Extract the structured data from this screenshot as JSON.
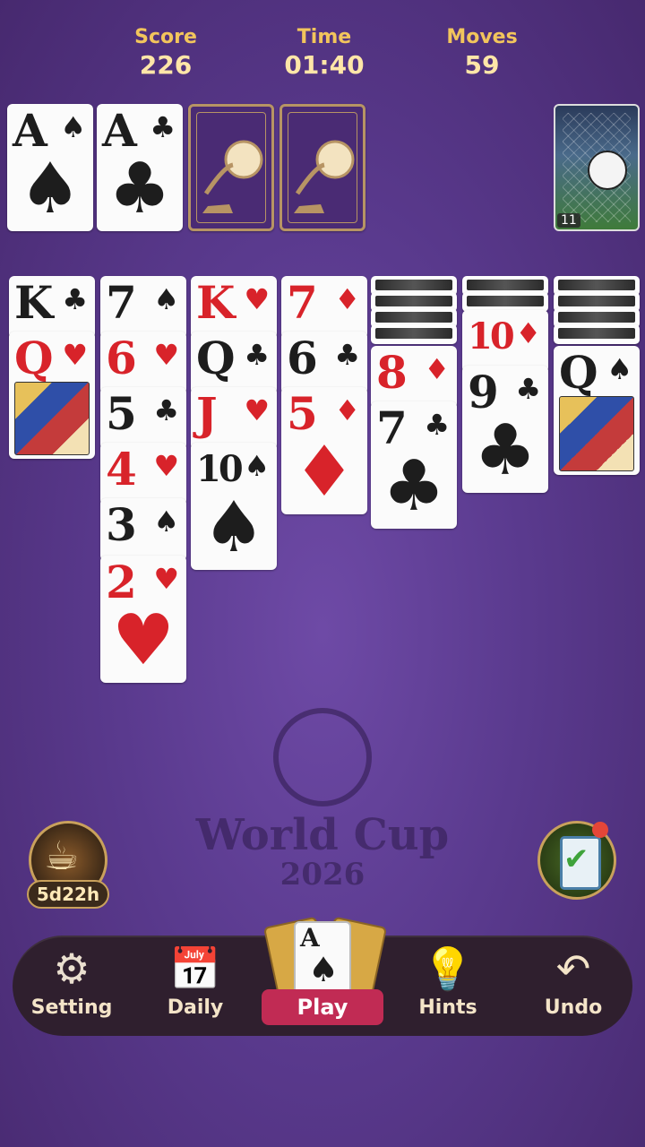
{
  "header": {
    "score": {
      "label": "Score",
      "value": "226"
    },
    "time": {
      "label": "Time",
      "value": "01:40"
    },
    "moves": {
      "label": "Moves",
      "value": "59"
    }
  },
  "foundations": [
    {
      "rank": "A",
      "suit": "♠",
      "color": "blk"
    },
    {
      "rank": "A",
      "suit": "♣",
      "color": "blk"
    }
  ],
  "stock": {
    "count": "11"
  },
  "tableau": {
    "col1": [
      {
        "rank": "K",
        "suit": "♣"
      },
      {
        "rank": "Q",
        "suit": "♥"
      }
    ],
    "col2": [
      {
        "rank": "7",
        "suit": "♠"
      },
      {
        "rank": "6",
        "suit": "♥"
      },
      {
        "rank": "5",
        "suit": "♣"
      },
      {
        "rank": "4",
        "suit": "♥"
      },
      {
        "rank": "3",
        "suit": "♠"
      },
      {
        "rank": "2",
        "suit": "♥"
      }
    ],
    "col3": [
      {
        "rank": "K",
        "suit": "♥"
      },
      {
        "rank": "Q",
        "suit": "♣"
      },
      {
        "rank": "J",
        "suit": "♥"
      },
      {
        "rank": "10",
        "suit": "♠"
      }
    ],
    "col4": [
      {
        "rank": "7",
        "suit": "♦"
      },
      {
        "rank": "6",
        "suit": "♣"
      },
      {
        "rank": "5",
        "suit": "♦"
      }
    ],
    "col5": [
      {
        "rank": "8",
        "suit": "♦"
      },
      {
        "rank": "7",
        "suit": "♣"
      }
    ],
    "col6": [
      {
        "rank": "10",
        "suit": "♦"
      },
      {
        "rank": "9",
        "suit": "♣"
      }
    ],
    "col7": [
      {
        "rank": "Q",
        "suit": "♠"
      }
    ]
  },
  "watermark": {
    "line1": "World Cup",
    "line2": "2026"
  },
  "event": {
    "timer": "5d22h"
  },
  "nav": {
    "setting": "Setting",
    "daily": "Daily",
    "play": "Play",
    "hints": "Hints",
    "undo": "Undo"
  },
  "colors": {
    "red": "#d8232a",
    "black": "#1d1d1d",
    "gold": "#f2c55c",
    "bg": "#5a3a8e"
  }
}
